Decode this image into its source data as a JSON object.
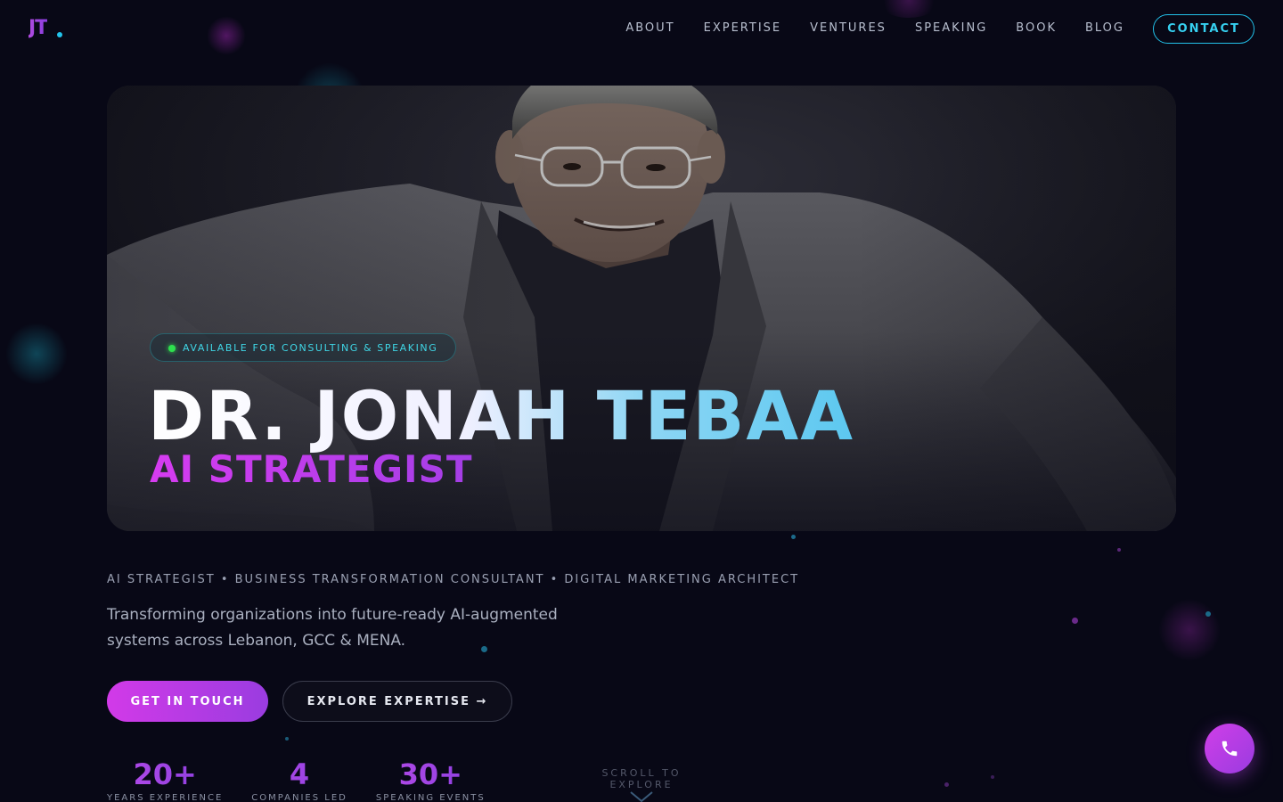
{
  "nav": {
    "logo": "JT",
    "links": [
      "ABOUT",
      "EXPERTISE",
      "VENTURES",
      "SPEAKING",
      "BOOK",
      "BLOG"
    ],
    "contact": "CONTACT"
  },
  "hero": {
    "badge": "AVAILABLE FOR CONSULTING & SPEAKING",
    "name": "DR. JONAH TEBAA",
    "role": "AI STRATEGIST"
  },
  "intro": {
    "titles": "AI STRATEGIST • BUSINESS TRANSFORMATION CONSULTANT • DIGITAL MARKETING ARCHITECT",
    "tagline": "Transforming organizations into future-ready AI-augmented systems across Lebanon, GCC & MENA.",
    "primary_cta": "GET IN TOUCH",
    "secondary_cta": "EXPLORE EXPERTISE →"
  },
  "stats": [
    {
      "value": "20+",
      "label": "YEARS EXPERIENCE"
    },
    {
      "value": "4",
      "label": "COMPANIES LED"
    },
    {
      "value": "30+",
      "label": "SPEAKING EVENTS"
    }
  ],
  "scroll_hint": "SCROLL TO EXPLORE",
  "colors": {
    "background": "#080816",
    "accent_purple": "#c03ce8",
    "accent_cyan": "#22c0e8",
    "status_green": "#2ee04e"
  },
  "icons": {
    "fab": "phone-icon",
    "scroll": "chevron-down-icon"
  }
}
